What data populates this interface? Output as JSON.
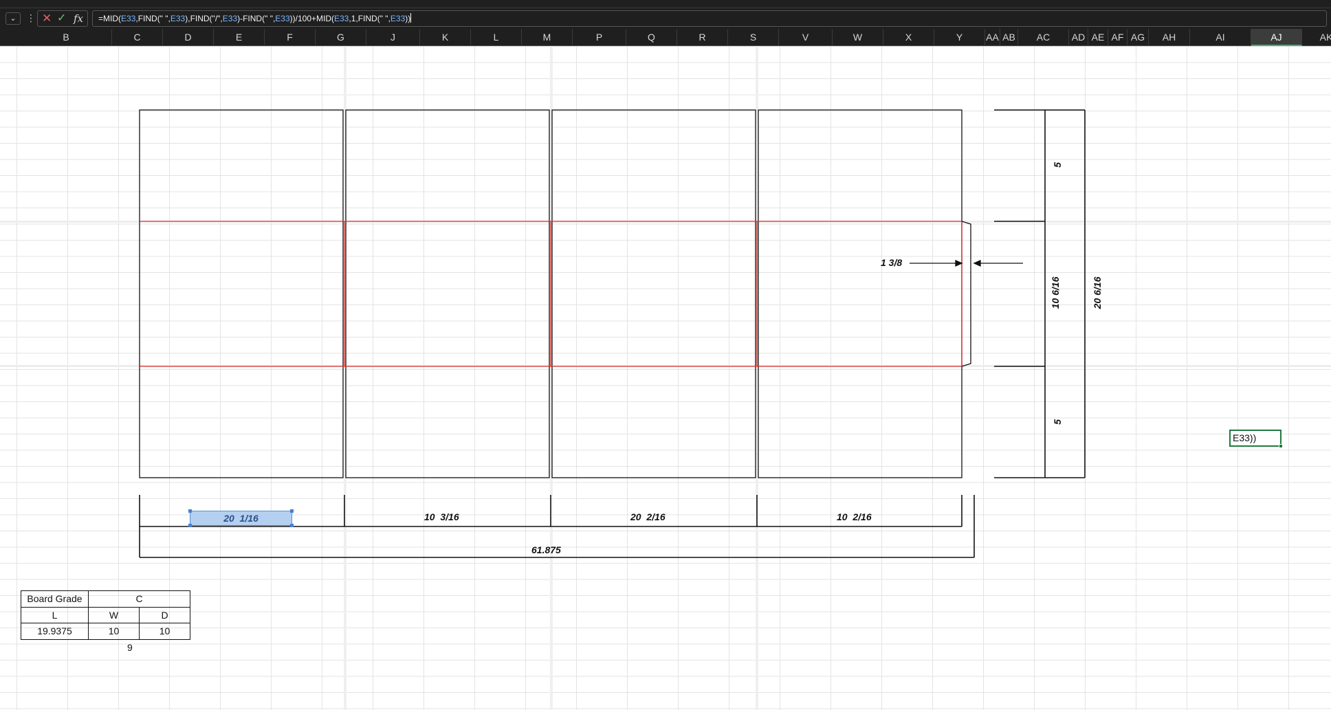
{
  "formula_bar": {
    "namebox_arrow": "⌄",
    "cancel_icon": "✕",
    "enter_icon": "✓",
    "fx_label": "fx",
    "formula_parts": [
      {
        "t": "=MID(",
        "ref": false
      },
      {
        "t": "E33",
        "ref": true
      },
      {
        "t": ",FIND(\" \",",
        "ref": false
      },
      {
        "t": "E33",
        "ref": true
      },
      {
        "t": "),FIND(\"/\",",
        "ref": false
      },
      {
        "t": "E33",
        "ref": true
      },
      {
        "t": ")-FIND(\" \",",
        "ref": false
      },
      {
        "t": "E33",
        "ref": true
      },
      {
        "t": "))/100+MID(",
        "ref": false
      },
      {
        "t": "E33",
        "ref": true
      },
      {
        "t": ",1,FIND(\" \",",
        "ref": false
      },
      {
        "t": "E33",
        "ref": true
      },
      {
        "t": "))",
        "ref": false
      }
    ]
  },
  "columns": [
    "B",
    "C",
    "D",
    "E",
    "F",
    "G",
    "J",
    "K",
    "L",
    "M",
    "P",
    "Q",
    "R",
    "S",
    "V",
    "W",
    "X",
    "Y",
    "AA",
    "AB",
    "AC",
    "AD",
    "AE",
    "AF",
    "AG",
    "AH",
    "AI",
    "AJ",
    "AK"
  ],
  "active_column": "AJ",
  "drawing": {
    "bottom_dims": [
      "20  1/16",
      "10  3/16",
      "20  2/16",
      "10  2/16"
    ],
    "total_length": "61.875",
    "glue_flap": "1 3/8",
    "right_dims": {
      "top_flap": "5",
      "body": "10 6/16",
      "bottom_flap": "5",
      "total": "20 6/16"
    }
  },
  "edit_cell": {
    "text": "E33))"
  },
  "board_table": {
    "grade_label": "Board Grade",
    "grade_value": "C",
    "headers": [
      "L",
      "W",
      "D"
    ],
    "values": [
      "19.9375",
      "10",
      "10"
    ]
  },
  "note": "9",
  "colors": {
    "score_line": "#e0302c",
    "cut_line": "#111111",
    "selection": "#b4cff0",
    "active_cell_border": "#1f7a3e"
  }
}
